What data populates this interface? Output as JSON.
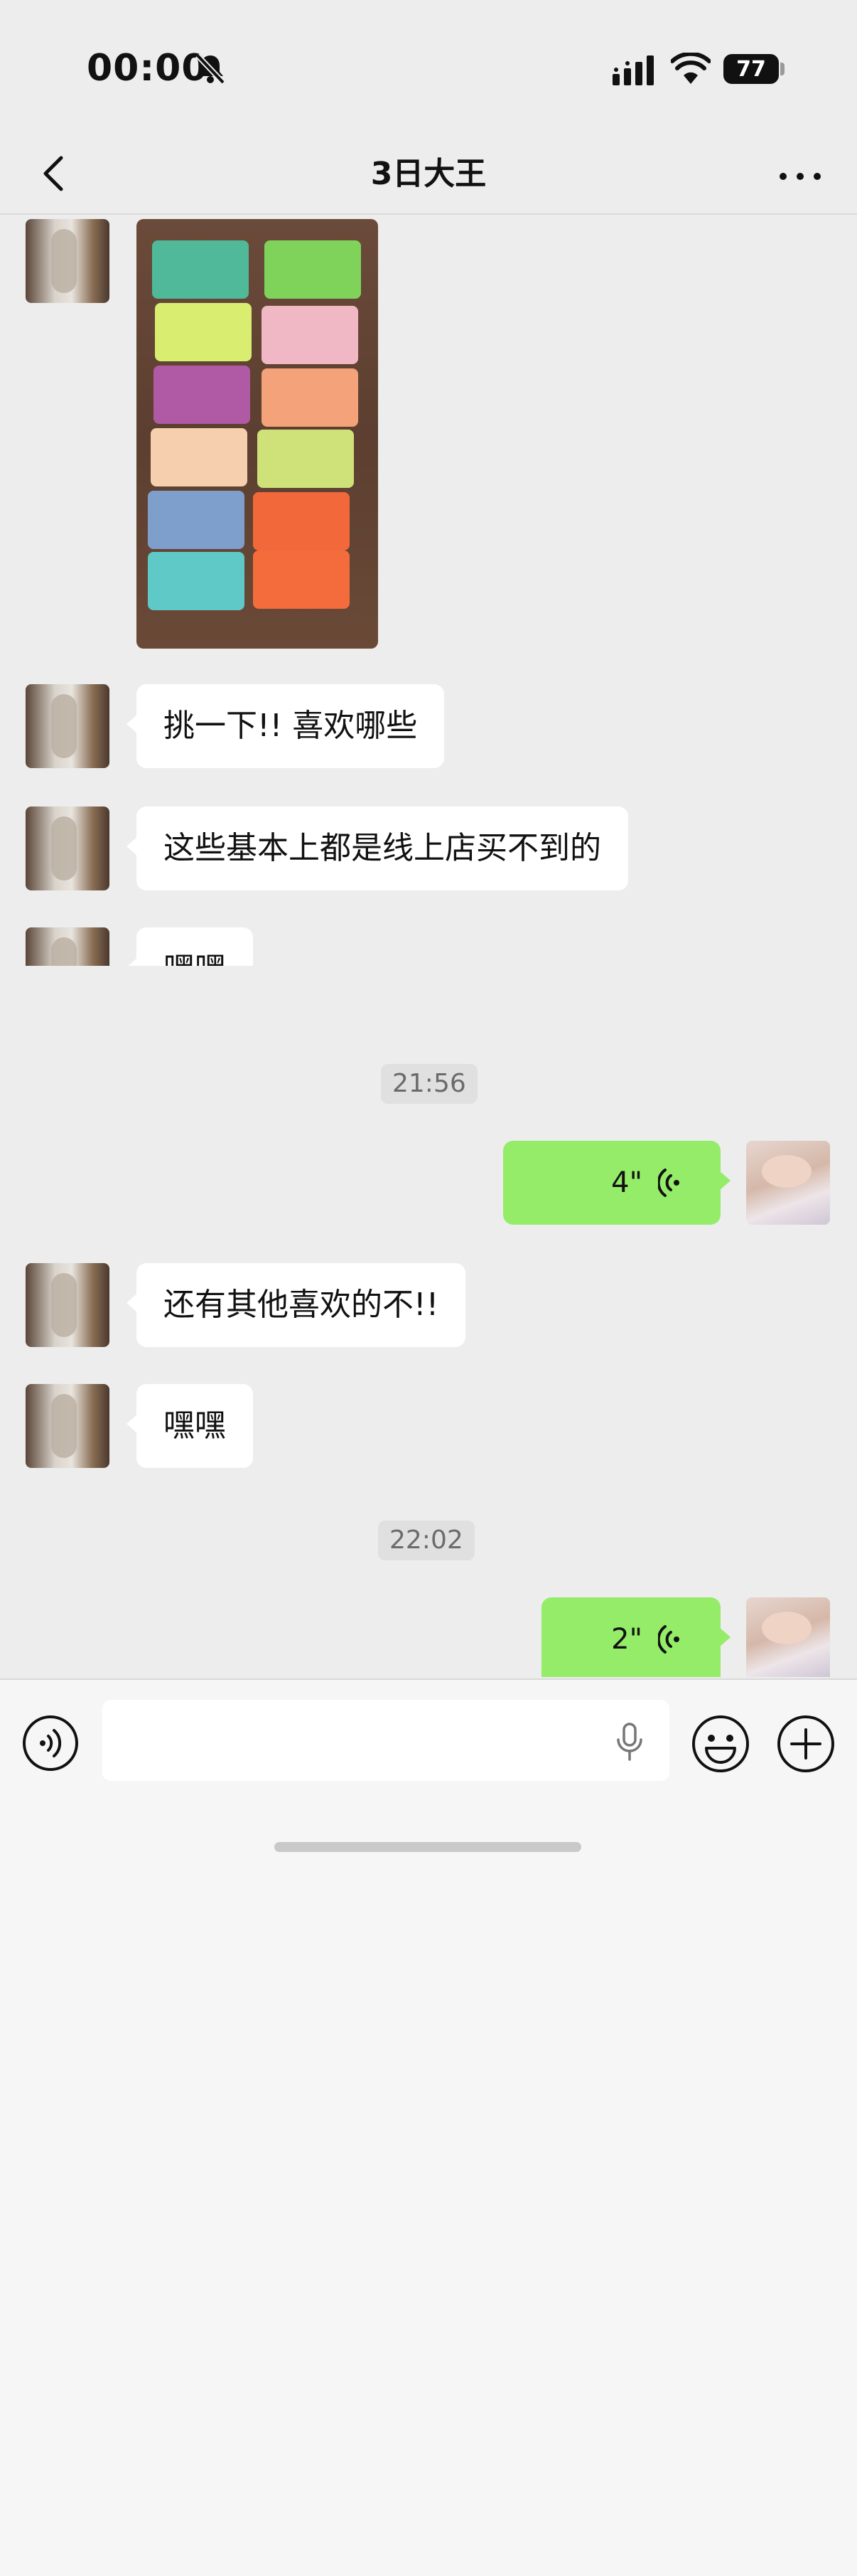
{
  "status_bar": {
    "time": "00:00",
    "battery": "77"
  },
  "nav": {
    "title": "3日大王"
  },
  "messages": {
    "text_1": "挑一下!!  喜欢哪些",
    "text_2": "这些基本上都是线上店买不到的",
    "text_3": "嘿嘿",
    "time_1": "21:56",
    "voice_1": "4\"",
    "text_4": "还有其他喜欢的不!!",
    "text_5": "嘿嘿",
    "time_2": "22:02",
    "voice_2": "2\""
  },
  "colors": {
    "me_bubble": "#95ec69",
    "other_bubble": "#ffffff",
    "background": "#ededed"
  }
}
